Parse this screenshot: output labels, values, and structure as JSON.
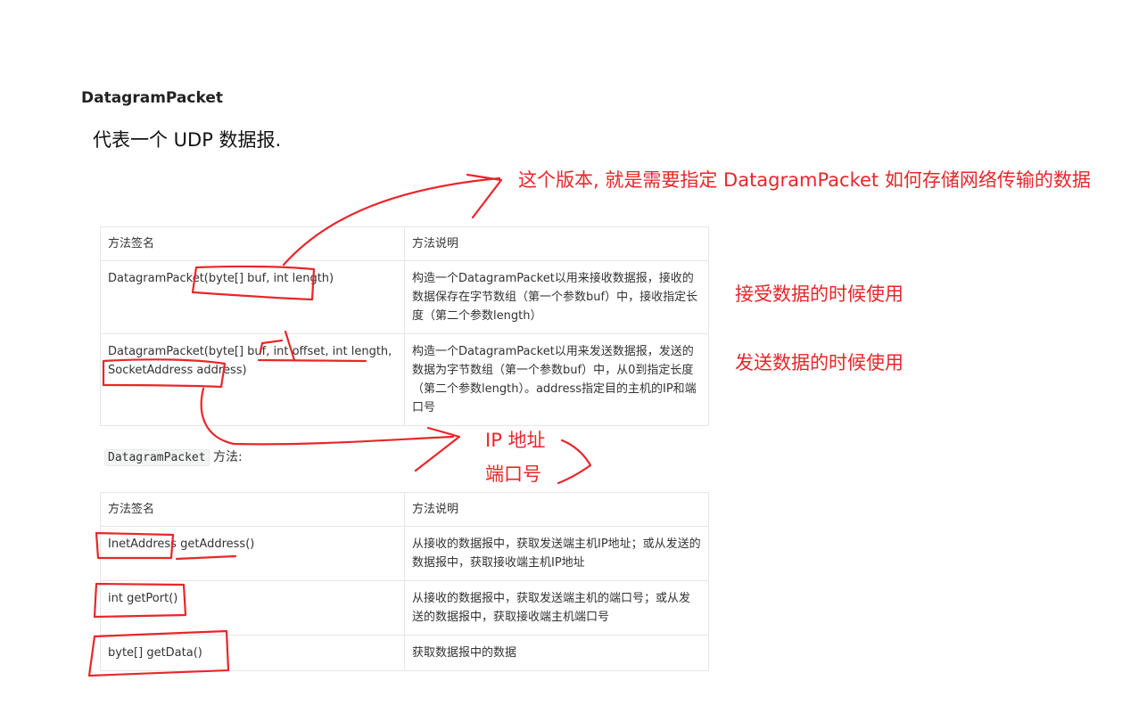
{
  "heading": "DatagramPacket",
  "subheading": "代表一个 UDP 数据报.",
  "annotations": {
    "version_note": "这个版本, 就是需要指定 DatagramPacket 如何存储网络传输的数据",
    "receive_note": "接受数据的时候使用",
    "send_note": "发送数据的时候使用",
    "ip_note": "IP 地址",
    "port_note": "端口号",
    "ink_color": "#e8262b"
  },
  "constructors_table": {
    "headers": [
      "方法签名",
      "方法说明"
    ],
    "rows": [
      {
        "signature": "DatagramPacket(byte[] buf, int length)",
        "description": "构造一个DatagramPacket以用来接收数据报，接收的数据保存在字节数组（第一个参数buf）中，接收指定长度（第二个参数length）"
      },
      {
        "signature": "DatagramPacket(byte[] buf, int offset, int length, SocketAddress address)",
        "description": "构造一个DatagramPacket以用来发送数据报，发送的数据为字节数组（第一个参数buf）中，从0到指定长度（第二个参数length）。address指定目的主机的IP和端口号"
      }
    ]
  },
  "methods_intro": {
    "code": "DatagramPacket",
    "text": " 方法:"
  },
  "methods_table": {
    "headers": [
      "方法签名",
      "方法说明"
    ],
    "rows": [
      {
        "signature": "InetAddress getAddress()",
        "description": "从接收的数据报中，获取发送端主机IP地址；或从发送的数据报中，获取接收端主机IP地址"
      },
      {
        "signature": "int getPort()",
        "description": "从接收的数据报中，获取发送端主机的端口号；或从发送的数据报中，获取接收端主机端口号"
      },
      {
        "signature": "byte[] getData()",
        "description": "获取数据报中的数据"
      }
    ]
  }
}
